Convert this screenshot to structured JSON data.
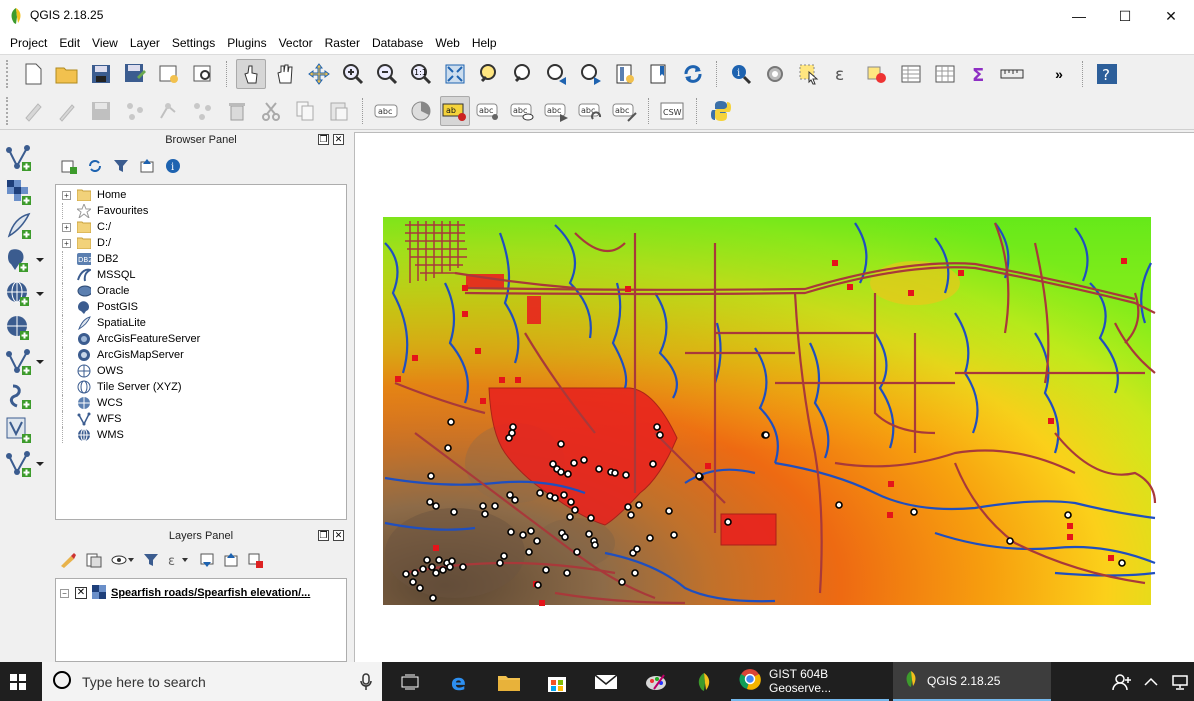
{
  "window": {
    "title": "QGIS 2.18.25",
    "controls": {
      "minimize": "—",
      "maximize": "☐",
      "close": "✕"
    }
  },
  "menubar": {
    "items": [
      "Project",
      "Edit",
      "View",
      "Layer",
      "Settings",
      "Plugins",
      "Vector",
      "Raster",
      "Database",
      "Web",
      "Help"
    ]
  },
  "toolbar2": {
    "csw_label": "CSW",
    "label_abc": "abc",
    "label_ab": "ab"
  },
  "browser_panel": {
    "title": "Browser Panel",
    "items": [
      {
        "label": "Home",
        "icon": "folder-icon",
        "expandable": true
      },
      {
        "label": "Favourites",
        "icon": "star-icon",
        "expandable": false
      },
      {
        "label": "C:/",
        "icon": "folder-icon",
        "expandable": true
      },
      {
        "label": "D:/",
        "icon": "folder-icon",
        "expandable": true
      },
      {
        "label": "DB2",
        "icon": "db2-icon",
        "expandable": false
      },
      {
        "label": "MSSQL",
        "icon": "mssql-icon",
        "expandable": false
      },
      {
        "label": "Oracle",
        "icon": "oracle-icon",
        "expandable": false
      },
      {
        "label": "PostGIS",
        "icon": "postgis-icon",
        "expandable": false
      },
      {
        "label": "SpatiaLite",
        "icon": "spatialite-icon",
        "expandable": false
      },
      {
        "label": "ArcGisFeatureServer",
        "icon": "arcgis-feature-icon",
        "expandable": false
      },
      {
        "label": "ArcGisMapServer",
        "icon": "arcgis-map-icon",
        "expandable": false
      },
      {
        "label": "OWS",
        "icon": "ows-icon",
        "expandable": false
      },
      {
        "label": "Tile Server (XYZ)",
        "icon": "xyz-icon",
        "expandable": false
      },
      {
        "label": "WCS",
        "icon": "wcs-icon",
        "expandable": false
      },
      {
        "label": "WFS",
        "icon": "wfs-icon",
        "expandable": false
      },
      {
        "label": "WMS",
        "icon": "wms-icon",
        "expandable": false
      }
    ],
    "db2_badge": "DB2"
  },
  "layers_panel": {
    "title": "Layers Panel",
    "layers": [
      {
        "label": "Spearfish roads/Spearfish elevation/...",
        "checked": true,
        "visibility_mark": "✕"
      }
    ]
  },
  "taskbar": {
    "search_placeholder": "Type here to search",
    "apps": [
      {
        "label": "GIST 604B Geoserve..."
      },
      {
        "label": "QGIS 2.18.25"
      }
    ]
  },
  "colors": {
    "accent": "#1e63b0",
    "polygon_fill": "#e8221e",
    "roads": "#a8393a",
    "streams": "#1f4fbf",
    "taskbar": "#1f1f1f"
  }
}
